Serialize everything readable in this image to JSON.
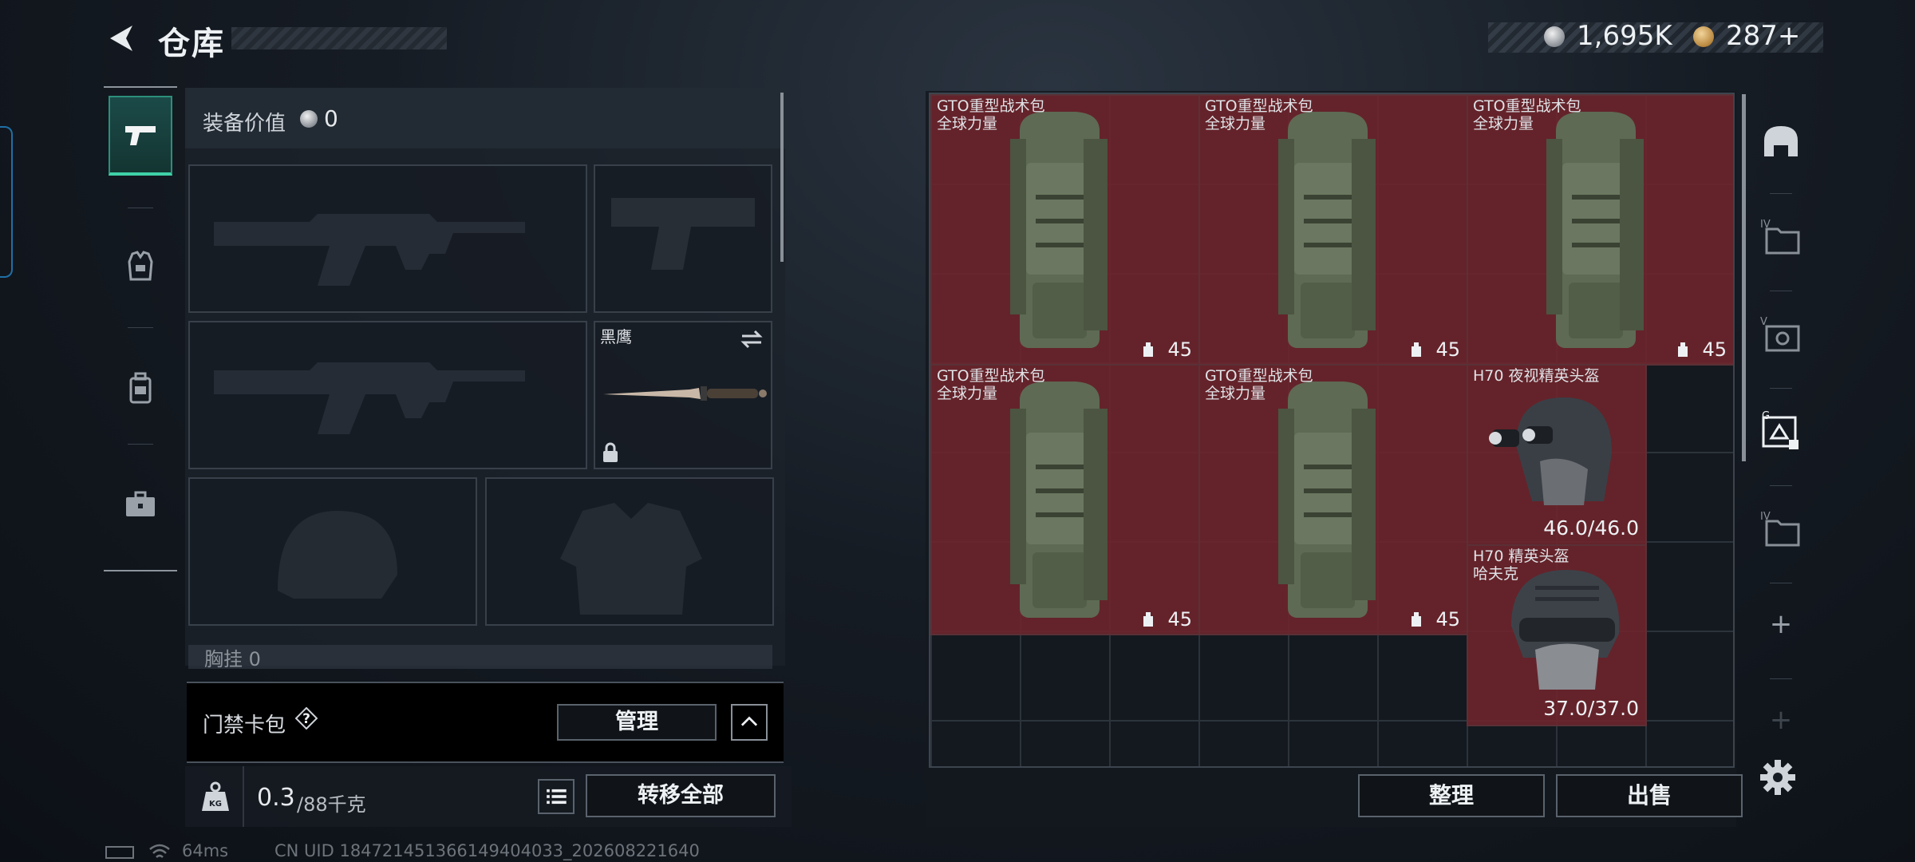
{
  "header": {
    "title": "仓库",
    "money": "1,695K",
    "tokens": "287+"
  },
  "equipment": {
    "value_label": "装备价值",
    "value": "0",
    "melee_name": "黑鹰",
    "section_label": "胸挂 0"
  },
  "card_bag": {
    "label": "门禁卡包",
    "help": "?",
    "manage_label": "管理"
  },
  "weight": {
    "current": "0.3",
    "rest": "/88千克",
    "transfer_label": "转移全部"
  },
  "status": {
    "ping": "64ms",
    "uid": "CN UID 184721451366149404033_202608221640"
  },
  "storage": {
    "items": [
      {
        "name": "GTO重型战术包",
        "sub": "全球力量",
        "value": "45"
      },
      {
        "name": "GTO重型战术包",
        "sub": "全球力量",
        "value": "45"
      },
      {
        "name": "GTO重型战术包",
        "sub": "全球力量",
        "value": "45"
      },
      {
        "name": "GTO重型战术包",
        "sub": "全球力量",
        "value": "45"
      },
      {
        "name": "GTO重型战术包",
        "sub": "全球力量",
        "value": "45"
      },
      {
        "name": "H70 夜视精英头盔",
        "sub": "",
        "value": "46.0/46.0"
      },
      {
        "name": "H70 精英头盔",
        "sub": "哈夫克",
        "value": "37.0/37.0"
      }
    ],
    "sort_label": "整理",
    "sell_label": "出售"
  },
  "right_rail": {
    "tab1": "IV",
    "tab2": "V",
    "tab3": "G",
    "tab4": "IV",
    "add1": "+",
    "add2": "+"
  }
}
